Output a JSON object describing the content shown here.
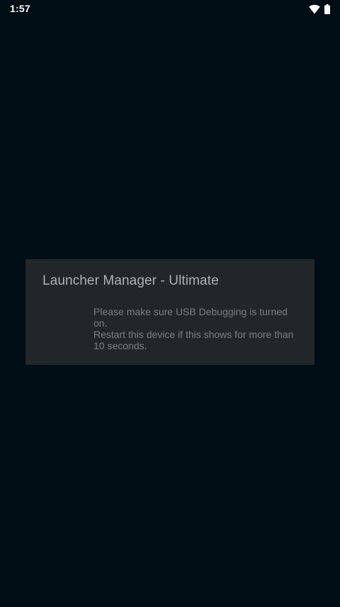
{
  "status_bar": {
    "time": "1:57",
    "icons": [
      "wifi-icon",
      "battery-icon"
    ]
  },
  "dialog": {
    "title": "Launcher Manager - Ultimate",
    "message_lines": [
      "Please make sure USB Debugging is turned on.",
      "Restart this device if this shows for more than 10 seconds."
    ]
  },
  "colors": {
    "background": "#000d14",
    "dialog_background": "#212629",
    "title_text": "#aeb3b6",
    "message_text": "#7b8083"
  }
}
